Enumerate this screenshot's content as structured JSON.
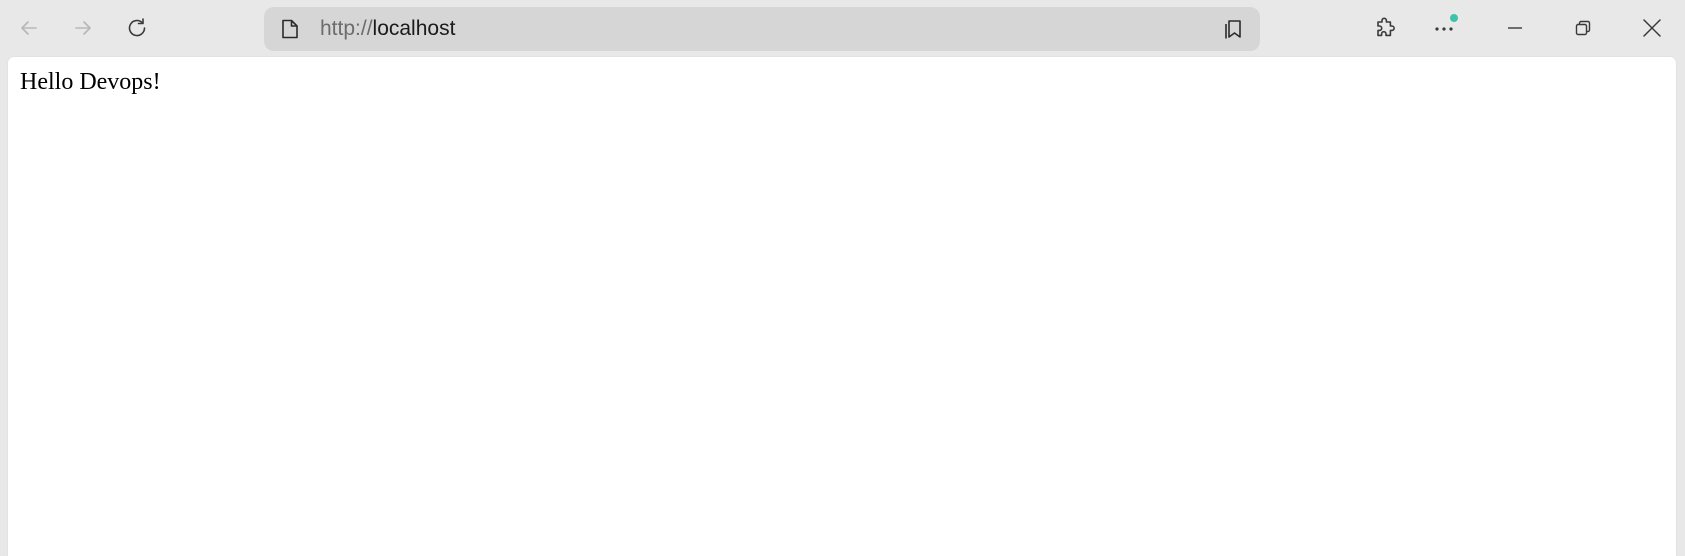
{
  "browser": {
    "address_bar": {
      "scheme": "http://",
      "host": "localhost"
    },
    "icons": {
      "back": "back-arrow-icon",
      "forward": "forward-arrow-icon",
      "refresh": "refresh-icon",
      "page": "page-icon",
      "favorites": "favorites-icon",
      "extensions": "extensions-icon",
      "more": "more-icon",
      "minimize": "minimize-icon",
      "restore": "restore-icon",
      "close": "close-icon"
    },
    "nav_state": {
      "back_enabled": false,
      "forward_enabled": false
    },
    "colors": {
      "toolbar_bg": "#e8e8e8",
      "address_bar_bg": "#d6d6d6",
      "notification_dot": "#3cc4a8"
    }
  },
  "page": {
    "body_text": "Hello Devops!"
  }
}
